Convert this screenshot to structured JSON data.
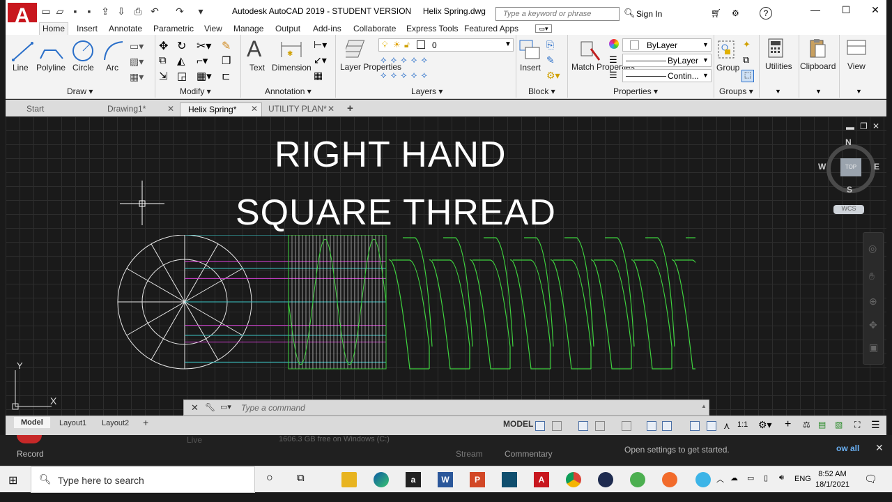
{
  "app": {
    "title": "Autodesk AutoCAD 2019 - STUDENT VERSION",
    "file": "Helix Spring.dwg",
    "logo_letter": "A",
    "search_placeholder": "Type a keyword or phrase",
    "sign_in": "Sign In"
  },
  "ribbon_tabs": [
    "Home",
    "Insert",
    "Annotate",
    "Parametric",
    "View",
    "Manage",
    "Output",
    "Add-ins",
    "Collaborate",
    "Express Tools",
    "Featured Apps"
  ],
  "ribbon": {
    "draw": {
      "title": "Draw",
      "line": "Line",
      "polyline": "Polyline",
      "circle": "Circle",
      "arc": "Arc"
    },
    "modify": {
      "title": "Modify"
    },
    "annotation": {
      "title": "Annotation",
      "text": "Text",
      "dimension": "Dimension"
    },
    "layers": {
      "title": "Layers",
      "layer_properties": "Layer Properties",
      "current_layer": "0"
    },
    "block": {
      "title": "Block",
      "insert": "Insert"
    },
    "properties": {
      "title": "Properties",
      "match_properties": "Match Properties",
      "color": "ByLayer",
      "lineweight": "ByLayer",
      "linetype": "Contin..."
    },
    "groups": {
      "title": "Groups",
      "group": "Group"
    },
    "utilities": {
      "title": "Utilities"
    },
    "clipboard": {
      "title": "Clipboard"
    },
    "view": {
      "title": "View"
    }
  },
  "doc_tabs": [
    "Start",
    "Drawing1*",
    "Helix Spring*",
    "UTILITY PLAN*"
  ],
  "active_doc_tab": "Helix Spring*",
  "overlay": {
    "line1": "RIGHT HAND",
    "line2": "SQUARE THREAD"
  },
  "viewcube": {
    "n": "N",
    "s": "S",
    "e": "E",
    "w": "W",
    "top": "TOP",
    "wcs": "WCS"
  },
  "ucs": {
    "x": "X",
    "y": "Y"
  },
  "command": {
    "placeholder": "Type  a  command"
  },
  "layout_tabs": [
    "Model",
    "Layout1",
    "Layout2"
  ],
  "status": {
    "model": "MODEL",
    "scale": "1:1"
  },
  "background_app": {
    "record": "Record",
    "disk": "1606.3 GB free on Windows (C:)",
    "stream": "Stream",
    "commentary": "Commentary",
    "notice": "Open settings to get started.",
    "show_all": "ow all",
    "live": "Live"
  },
  "taskbar": {
    "search": "Type here to search",
    "lang": "ENG",
    "time": "8:52 AM",
    "date": "18/1/2021"
  },
  "colors": {
    "spring": "#3fd23f",
    "projection_cyan": "#3cc8c8",
    "projection_magenta": "#d040d0",
    "circle": "#e8e8e8",
    "logo": "#c8171e"
  }
}
